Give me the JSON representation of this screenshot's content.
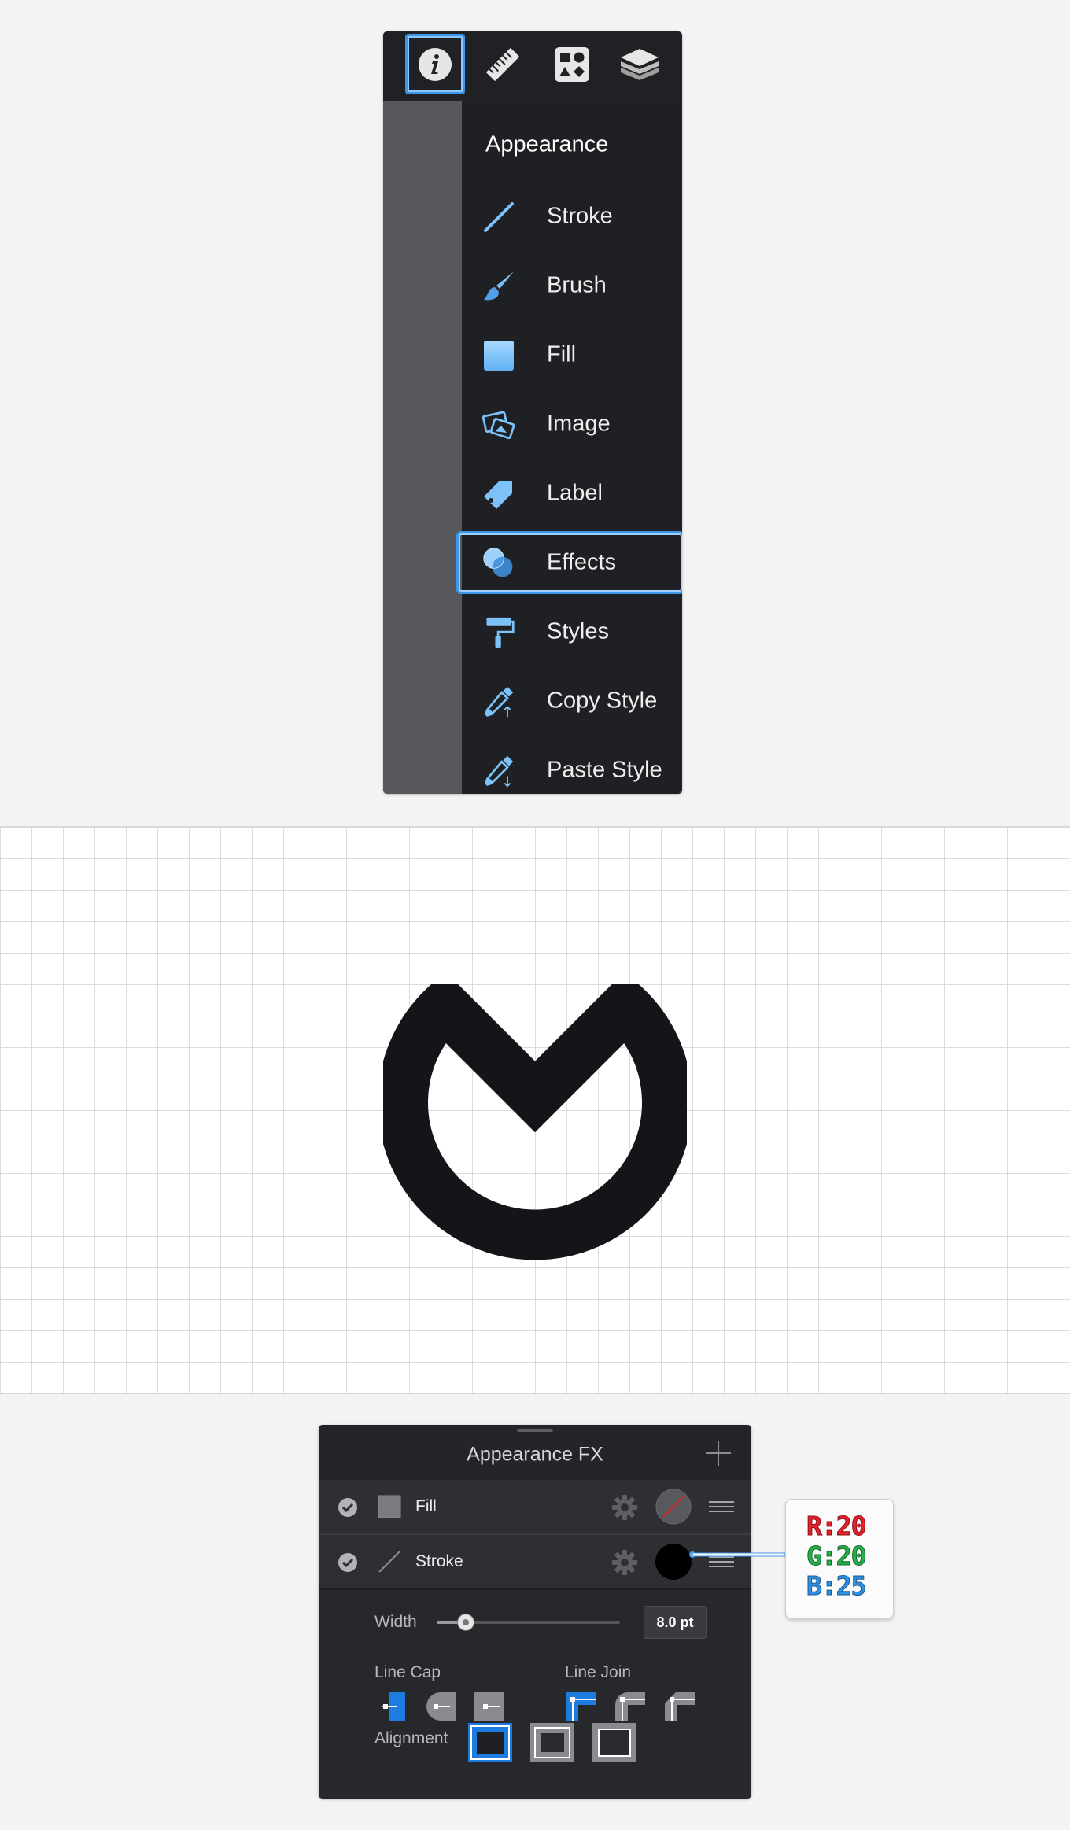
{
  "menu": {
    "toolbar": [
      {
        "icon": "info-icon",
        "selected": true
      },
      {
        "icon": "ruler-icon",
        "selected": false
      },
      {
        "icon": "shapes-icon",
        "selected": false
      },
      {
        "icon": "layers-icon",
        "selected": false
      }
    ],
    "heading": "Appearance",
    "items": [
      {
        "label": "Stroke",
        "icon": "stroke-line-icon"
      },
      {
        "label": "Brush",
        "icon": "brush-icon"
      },
      {
        "label": "Fill",
        "icon": "fill-square-icon"
      },
      {
        "label": "Image",
        "icon": "image-icon"
      },
      {
        "label": "Label",
        "icon": "label-tag-icon"
      },
      {
        "label": "Effects",
        "icon": "effects-circles-icon",
        "selected": true
      },
      {
        "label": "Styles",
        "icon": "paint-roller-icon"
      },
      {
        "label": "Copy Style",
        "icon": "eyedropper-copy-icon"
      },
      {
        "label": "Paste Style",
        "icon": "eyedropper-paste-icon"
      }
    ],
    "accent": "#3d97e8",
    "icon_color": "#7cc1f7"
  },
  "canvas": {
    "shape_color": "#141419"
  },
  "fx_panel": {
    "title": "Appearance FX",
    "rows": [
      {
        "label": "Fill",
        "enabled": true,
        "color": "none"
      },
      {
        "label": "Stroke",
        "enabled": true,
        "color": "#141419"
      }
    ],
    "width_label": "Width",
    "width_value": "8.0 pt",
    "width_slider_fraction": 0.16,
    "line_cap_label": "Line Cap",
    "line_join_label": "Line Join",
    "alignment_label": "Alignment",
    "selected_cap": "butt",
    "selected_join": "miter",
    "selected_alignment": "inside"
  },
  "rgb_callout": {
    "r": "R:20",
    "g": "G:20",
    "b": "B:25"
  }
}
